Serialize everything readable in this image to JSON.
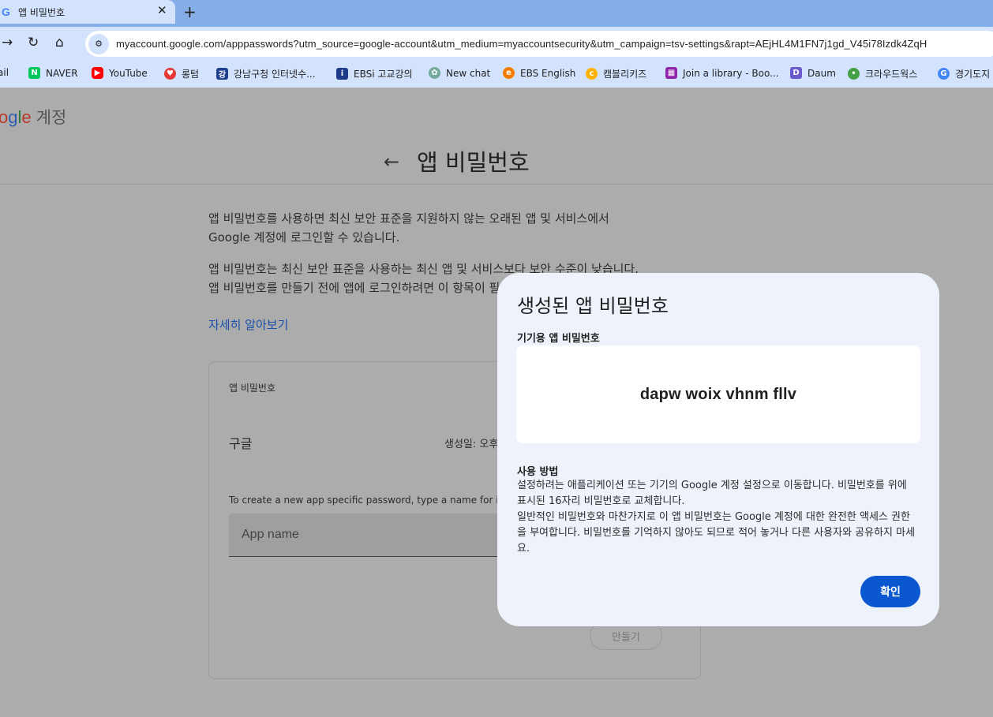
{
  "browser": {
    "tab": {
      "title": "앱 비밀번호",
      "favicon": "G"
    },
    "url": "myaccount.google.com/apppasswords?utm_source=google-account&utm_medium=myaccountsecurity&utm_campaign=tsv-settings&rapt=AEjHL4M1FN7j1gd_V45i78Izdk4ZqH",
    "bookmarks": [
      {
        "label": "ail",
        "icon": "gmail-icon",
        "color": "#d93025"
      },
      {
        "label": "NAVER",
        "icon": "naver-icon",
        "color": "#03c75a"
      },
      {
        "label": "YouTube",
        "icon": "youtube-icon",
        "color": "#ff0000"
      },
      {
        "label": "롱텀",
        "icon": "heart-icon",
        "color": "#e53935"
      },
      {
        "label": "강남구청 인터넷수...",
        "icon": "gangnam-icon",
        "color": "#1f3f8f"
      },
      {
        "label": "EBSi 고교강의",
        "icon": "ebsi-icon",
        "color": "#1e3a8a"
      },
      {
        "label": "New chat",
        "icon": "chatgpt-icon",
        "color": "#74aa9c"
      },
      {
        "label": "EBS English",
        "icon": "ebs-icon",
        "color": "#f57c00"
      },
      {
        "label": "캠블리키즈",
        "icon": "cambly-icon",
        "color": "#ffb300"
      },
      {
        "label": "Join a library - Boo...",
        "icon": "library-icon",
        "color": "#8e24aa"
      },
      {
        "label": "Daum",
        "icon": "daum-icon",
        "color": "#6a5acd"
      },
      {
        "label": "크라우드웍스",
        "icon": "crowdworks-icon",
        "color": "#43a047"
      },
      {
        "label": "경기도지",
        "icon": "google-icon",
        "color": "#4285f4"
      }
    ]
  },
  "page": {
    "logo_letters": [
      "o",
      "g",
      "l",
      "e"
    ],
    "account_label": "계정",
    "title": "앱 비밀번호",
    "intro_1": "앱 비밀번호를 사용하면 최신 보안 표준을 지원하지 않는 오래된 앱 및 서비스에서 Google 계정에 로그인할 수 있습니다.",
    "intro_2": "앱 비밀번호는 최신 보안 표준을 사용하는 최신 앱 및 서비스보다 보안 수준이 낮습니다. 앱 비밀번호를 만들기 전에 앱에 로그인하려면 이 항목이 필요한지 확인해야 합니다.",
    "learn_more": "자세히 알아보기",
    "card": {
      "label": "앱 비밀번호",
      "app_name": "구글",
      "created": "생성일: 오후",
      "hint": "To create a new app specific password, type a name for it below",
      "input_placeholder": "App name",
      "create_button": "만들기"
    }
  },
  "dialog": {
    "title": "생성된 앱 비밀번호",
    "device_label": "기기용 앱 비밀번호",
    "password": "dapw woix vhnm fllv",
    "usage_title": "사용 방법",
    "usage_text_1": "설정하려는 애플리케이션 또는 기기의 Google 계정 설정으로 이동합니다. 비밀번호를 위에 표시된 16자리 비밀번호로 교체합니다.",
    "usage_text_2": "일반적인 비밀번호와 마찬가지로 이 앱 비밀번호는 Google 계정에 대한 완전한 액세스 권한을 부여합니다. 비밀번호를 기억하지 않아도 되므로 적어 놓거나 다른 사용자와 공유하지 마세요.",
    "ok_button": "확인"
  },
  "colors": {
    "accent": "#0b57d0",
    "link": "#1a4fa8",
    "dialog_bg": "#eef2fb"
  }
}
